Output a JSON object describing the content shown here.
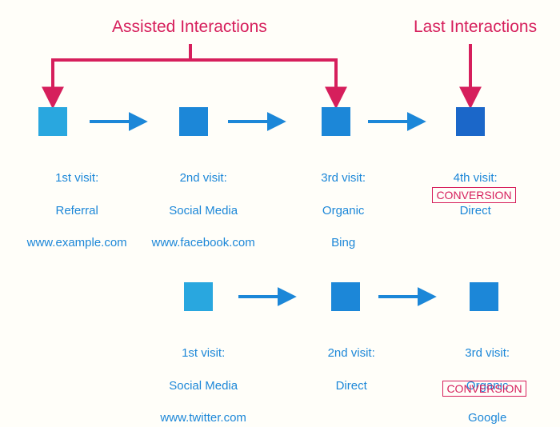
{
  "headings": {
    "assisted": "Assisted Interactions",
    "last": "Last Interactions"
  },
  "colors": {
    "accent_pink": "#d61f5c",
    "light_blue": "#29a7df",
    "mid_blue": "#1c87d8",
    "dark_blue": "#1b67c9"
  },
  "path1": {
    "visits": [
      {
        "title": "1st visit:",
        "channel": "Referral",
        "detail": "www.example.com"
      },
      {
        "title": "2nd visit:",
        "channel": "Social Media",
        "detail": "www.facebook.com"
      },
      {
        "title": "3rd visit:",
        "channel": "Organic",
        "detail": "Bing"
      },
      {
        "title": "4th visit:",
        "channel": "Direct",
        "detail": ""
      }
    ],
    "conversion": "CONVERSION"
  },
  "path2": {
    "visits": [
      {
        "title": "1st visit:",
        "channel": "Social Media",
        "detail": "www.twitter.com"
      },
      {
        "title": "2nd visit:",
        "channel": "Direct",
        "detail": ""
      },
      {
        "title": "3rd visit:",
        "channel": "Organic",
        "detail": "Google"
      }
    ],
    "conversion": "CONVERSION"
  }
}
